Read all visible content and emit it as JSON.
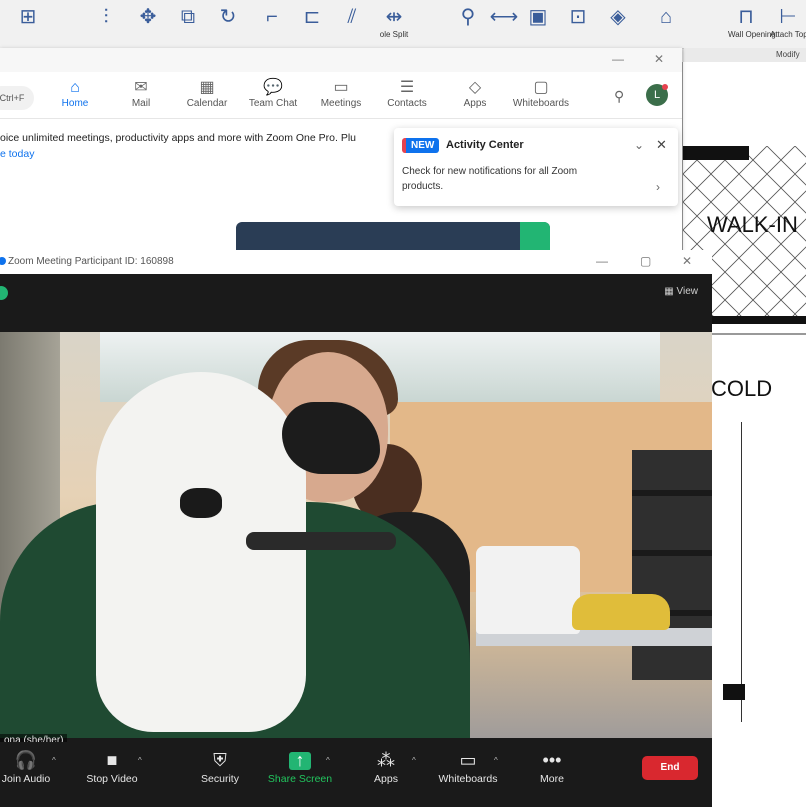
{
  "cad": {
    "ribbon_tools": [
      {
        "icon": "snap-grid-icon",
        "glyph": "⊞",
        "label": ""
      },
      {
        "icon": "align-icon",
        "glyph": "⫶",
        "label": ""
      },
      {
        "icon": "move-icon",
        "glyph": "✥",
        "label": ""
      },
      {
        "icon": "copy-icon",
        "glyph": "⧉",
        "label": ""
      },
      {
        "icon": "rotate-icon",
        "glyph": "↻",
        "label": ""
      },
      {
        "icon": "trim-icon",
        "glyph": "⌐",
        "label": ""
      },
      {
        "icon": "offset-icon",
        "glyph": "⊏",
        "label": ""
      },
      {
        "icon": "mirror-icon",
        "glyph": "⫽",
        "label": ""
      },
      {
        "icon": "split-icon",
        "glyph": "⇹",
        "label": "ole Split"
      },
      {
        "icon": "pin-icon",
        "glyph": "⚲",
        "label": ""
      },
      {
        "icon": "measure-icon",
        "glyph": "⟷",
        "label": ""
      },
      {
        "icon": "create-icon",
        "glyph": "▣",
        "label": ""
      },
      {
        "icon": "group-icon",
        "glyph": "⊡",
        "label": ""
      },
      {
        "icon": "edit-icon",
        "glyph": "◈",
        "label": ""
      },
      {
        "icon": "family-icon",
        "glyph": "⌂",
        "label": ""
      },
      {
        "icon": "wall-opening-icon",
        "glyph": "⊓",
        "label": "Wall Opening"
      },
      {
        "icon": "attach-icon",
        "glyph": "⊢",
        "label": "Attach Top/Bas"
      }
    ],
    "ribbon_group_label": "Modify",
    "drawing_labels": [
      "WALK-IN",
      "COLD"
    ]
  },
  "zoom_main": {
    "nav": [
      {
        "icon": "home-icon",
        "glyph": "⌂",
        "label": "Home",
        "active": true
      },
      {
        "icon": "mail-icon",
        "glyph": "✉",
        "label": "Mail",
        "active": false
      },
      {
        "icon": "calendar-icon",
        "glyph": "▦",
        "label": "Calendar",
        "active": false
      },
      {
        "icon": "chat-icon",
        "glyph": "💬",
        "label": "Team Chat",
        "active": false
      },
      {
        "icon": "meetings-icon",
        "glyph": "▭",
        "label": "Meetings",
        "active": false
      },
      {
        "icon": "contacts-icon",
        "glyph": "☰",
        "label": "Contacts",
        "active": false
      },
      {
        "icon": "apps-icon",
        "glyph": "◇",
        "label": "Apps",
        "active": false
      },
      {
        "icon": "whiteboards-icon",
        "glyph": "▢",
        "label": "Whiteboards",
        "active": false
      }
    ],
    "search_pill": "Ctrl+F",
    "banner_text": "oice unlimited meetings, productivity apps and more with Zoom One Pro. Plu",
    "banner_link": "e today"
  },
  "activity_center": {
    "badge": "NEW",
    "title": "Activity Center",
    "body": "Check for new notifications for all Zoom products."
  },
  "meeting": {
    "title": "Zoom Meeting Participant ID: 160898",
    "view_label": "View",
    "name_tag": "ona (she/her)",
    "toolbar": [
      {
        "icon": "headphones-icon",
        "glyph": "🎧",
        "label": "Join Audio",
        "caret": true
      },
      {
        "icon": "video-camera-icon",
        "glyph": "■",
        "label": "Stop Video",
        "caret": true
      },
      {
        "icon": "shield-icon",
        "glyph": "⛨",
        "label": "Security",
        "caret": false
      },
      {
        "icon": "share-screen-icon",
        "glyph": "↑",
        "label": "Share Screen",
        "caret": true
      },
      {
        "icon": "apps-icon",
        "glyph": "⁂",
        "label": "Apps",
        "caret": true
      },
      {
        "icon": "whiteboard-icon",
        "glyph": "▭",
        "label": "Whiteboards",
        "caret": true
      },
      {
        "icon": "more-icon",
        "glyph": "•••",
        "label": "More",
        "caret": false
      }
    ],
    "end_label": "End"
  }
}
